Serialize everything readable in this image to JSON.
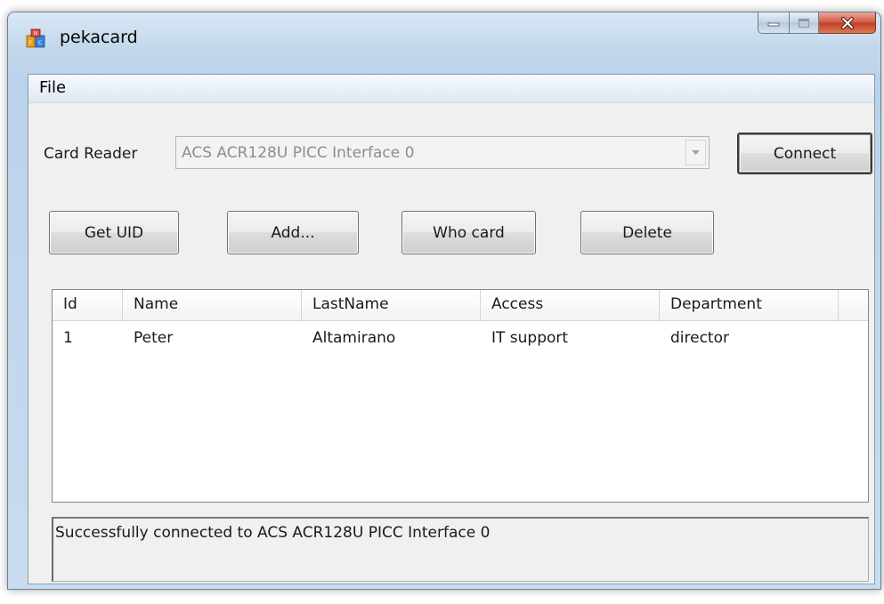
{
  "window": {
    "title": "pekacard",
    "app_icon": "nfc-app-icon",
    "minimize_icon": "minimize-icon",
    "maximize_icon": "maximize-icon",
    "close_icon": "close-icon"
  },
  "menu": {
    "items": [
      {
        "label": "File"
      }
    ]
  },
  "reader": {
    "label": "Card Reader",
    "selected": "ACS ACR128U PICC Interface 0",
    "connect_label": "Connect"
  },
  "actions": {
    "get_uid": "Get UID",
    "add": "Add...",
    "who_card": "Who card",
    "delete": "Delete"
  },
  "table": {
    "columns": [
      "Id",
      "Name",
      "LastName",
      "Access",
      "Department"
    ],
    "rows": [
      {
        "id": "1",
        "name": "Peter",
        "last_name": "Altamirano",
        "access": "IT support",
        "department": "director"
      }
    ]
  },
  "status": {
    "text": "Successfully connected to  ACS ACR128U PICC Interface 0"
  },
  "colors": {
    "title_bar": "#c4d8ec",
    "close_button": "#c23d25",
    "client_bg": "#f0f0f0"
  }
}
